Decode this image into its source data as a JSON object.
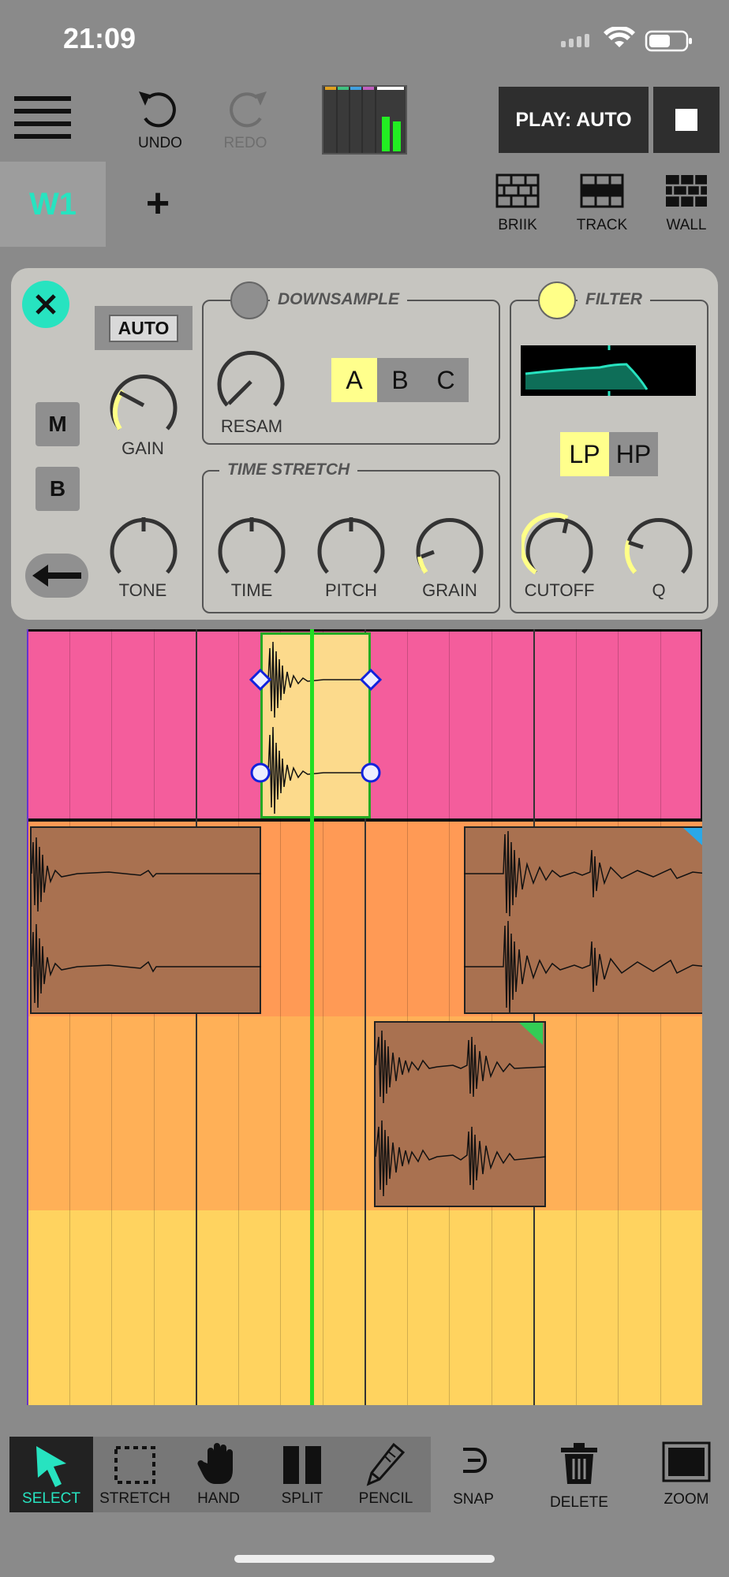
{
  "status": {
    "time": "21:09"
  },
  "toolbar": {
    "undo_label": "UNDO",
    "redo_label": "REDO",
    "play_label": "PLAY: AUTO"
  },
  "tabs": {
    "active": "W1",
    "add": "+"
  },
  "views": {
    "briik": "BRIIK",
    "track": "TRACK",
    "wall": "WALL"
  },
  "panel": {
    "auto_label": "AUTO",
    "mute_label": "M",
    "b_label": "B",
    "gain_label": "GAIN",
    "tone_label": "TONE",
    "downsample": {
      "title": "DOWNSAMPLE",
      "resam_label": "RESAM",
      "modes": [
        "A",
        "B",
        "C"
      ],
      "selected_mode": "A"
    },
    "time_stretch": {
      "title": "TIME STRETCH",
      "time_label": "TIME",
      "pitch_label": "PITCH",
      "grain_label": "GRAIN"
    },
    "filter": {
      "title": "FILTER",
      "lp_label": "LP",
      "hp_label": "HP",
      "selected": "LP",
      "cutoff_label": "CUTOFF",
      "q_label": "Q"
    }
  },
  "colors": {
    "accent": "#27e3c0",
    "lane1": "#f45d9c",
    "lane2": "#ff9a55",
    "lane3": "#ffb057",
    "lane4": "#ffd35f",
    "selection": "#fcda8c",
    "playhead": "#22dd22",
    "active_led": "#ffff88",
    "selected_button": "#ffff8c"
  },
  "tools": {
    "select": "SELECT",
    "stretch": "STRETCH",
    "hand": "HAND",
    "split": "SPLIT",
    "pencil": "PENCIL",
    "snap": "SNAP",
    "delete": "DELETE",
    "zoom": "ZOOM",
    "active": "SELECT"
  },
  "icons": [
    "menu-icon",
    "undo-icon",
    "redo-icon",
    "level-meter-icon",
    "stop-icon",
    "brick-icon",
    "close-icon",
    "back-arrow-icon",
    "select-arrow-icon",
    "stretch-icon",
    "hand-icon",
    "split-icon",
    "pencil-icon",
    "snap-icon",
    "trash-icon",
    "zoom-icon"
  ]
}
